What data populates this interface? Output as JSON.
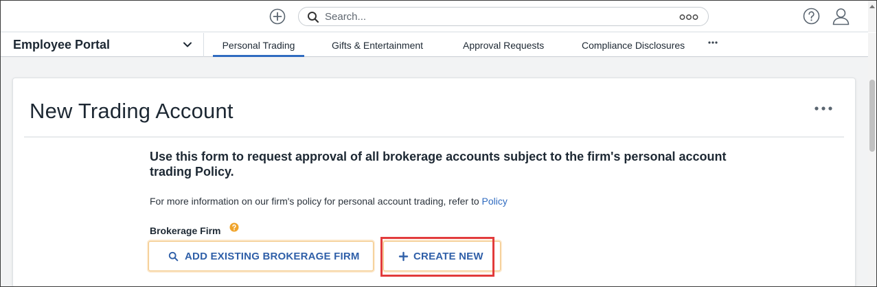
{
  "topbar": {
    "add_icon": "plus-circle-icon",
    "search": {
      "placeholder": "Search...",
      "value": ""
    },
    "help_icon": "question-circle-icon",
    "user_icon": "user-icon"
  },
  "nav": {
    "portal": "Employee Portal",
    "tabs": [
      {
        "label": "Personal Trading",
        "active": true
      },
      {
        "label": "Gifts & Entertainment",
        "active": false
      },
      {
        "label": "Approval Requests",
        "active": false
      },
      {
        "label": "Compliance Disclosures",
        "active": false
      }
    ],
    "more_icon": "ellipsis-icon"
  },
  "form": {
    "title": "New Trading Account",
    "intro": "Use this form to request approval of all brokerage accounts subject to the firm's personal account trading Policy.",
    "info_prefix": "For more information on our firm's policy for personal account trading, refer to ",
    "info_link": "Policy",
    "field_label": "Brokerage Firm",
    "buttons": {
      "add_existing": "ADD EXISTING BROKERAGE FIRM",
      "create_new": "CREATE NEW"
    }
  },
  "colors": {
    "accent": "#2f6bc0",
    "button_text": "#2f5fa8",
    "button_border": "#f1c27a",
    "highlight": "#e23b3b",
    "help_badge": "#f0a42b"
  }
}
